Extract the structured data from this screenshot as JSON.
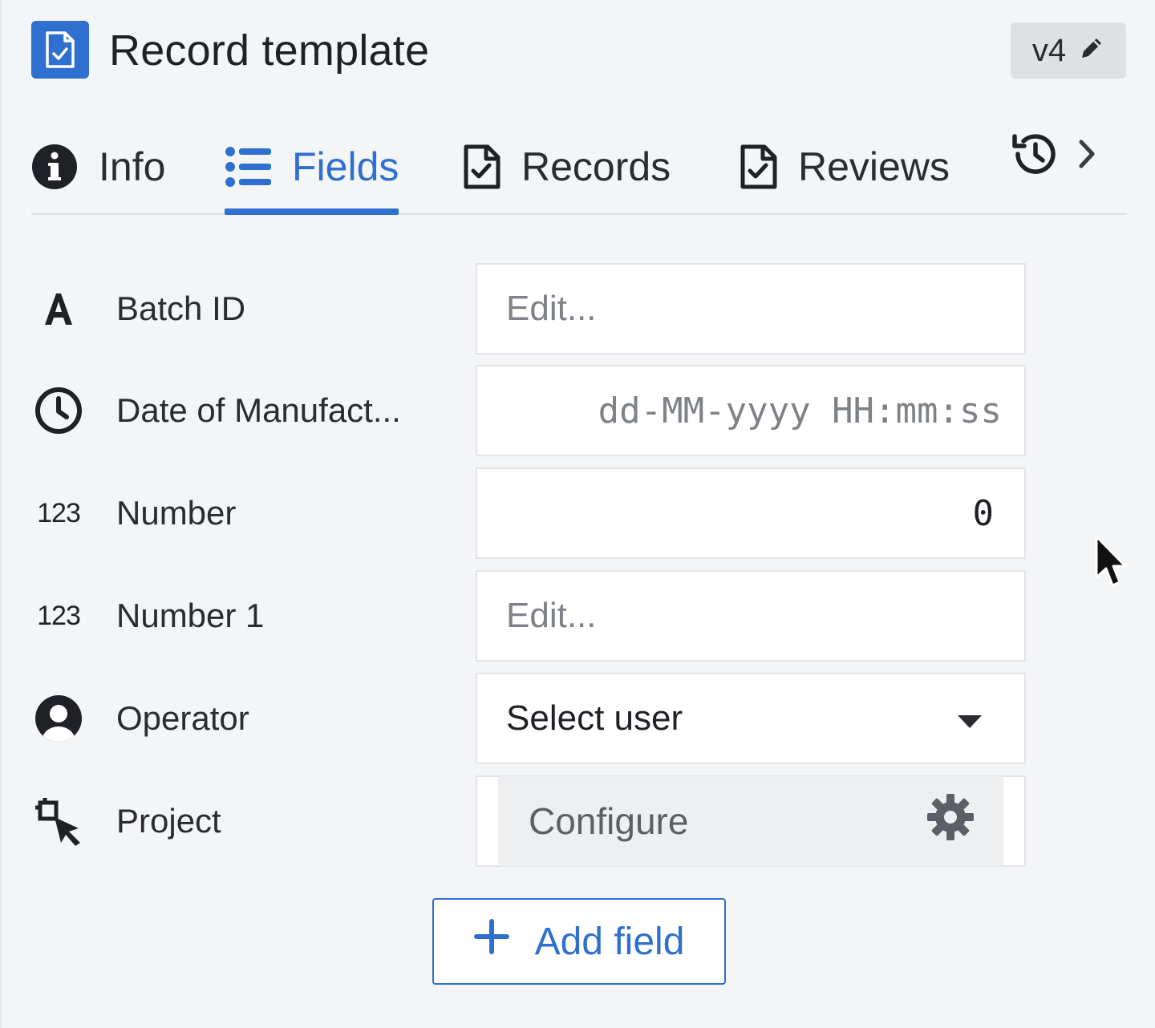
{
  "header": {
    "title": "Record template",
    "version": "v4"
  },
  "tabs": [
    {
      "label": "Info",
      "icon": "info-icon"
    },
    {
      "label": "Fields",
      "icon": "list-icon",
      "active": true
    },
    {
      "label": "Records",
      "icon": "document-check-icon"
    },
    {
      "label": "Reviews",
      "icon": "document-check-icon"
    }
  ],
  "fields": [
    {
      "label": "Batch ID",
      "icon": "text-type-icon",
      "placeholder": "Edit..."
    },
    {
      "label": "Date of Manufact...",
      "icon": "clock-icon",
      "placeholder": "dd-MM-yyyy HH:mm:ss"
    },
    {
      "label": "Number",
      "icon": "number-type-icon",
      "icon_text": "123",
      "value": "0"
    },
    {
      "label": "Number 1",
      "icon": "number-type-icon",
      "icon_text": "123",
      "placeholder": "Edit..."
    },
    {
      "label": "Operator",
      "icon": "user-icon",
      "value": "Select user"
    },
    {
      "label": "Project",
      "icon": "select-tool-icon",
      "button": "Configure"
    }
  ],
  "add_field_label": "Add field",
  "colors": {
    "accent": "#2f6fcf",
    "text": "#2a2c30",
    "muted": "#7e8287"
  }
}
